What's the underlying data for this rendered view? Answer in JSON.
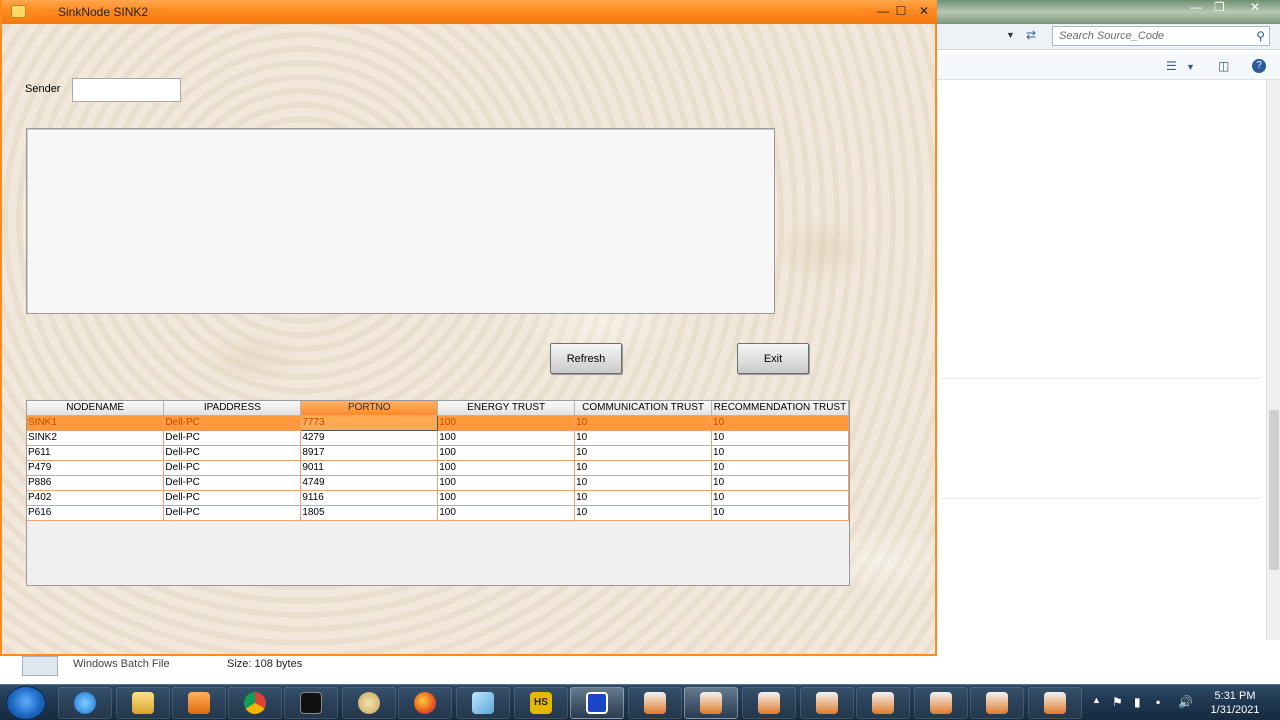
{
  "app": {
    "title": "SinkNode SINK2",
    "sender_label": "Sender",
    "sender_value": "",
    "message_text": "",
    "refresh_label": "Refresh",
    "exit_label": "Exit"
  },
  "table": {
    "columns": [
      "NODENAME",
      "IPADDRESS",
      "PORTNO",
      "ENERGY TRUST",
      "COMMUNICATION TRUST",
      "RECOMMENDATION TRUST"
    ],
    "selected_column": "PORTNO",
    "rows": [
      [
        "SINK1",
        "Dell-PC",
        "7773",
        "100",
        "10",
        "10"
      ],
      [
        "SINK2",
        "Dell-PC",
        "4279",
        "100",
        "10",
        "10"
      ],
      [
        "P611",
        "Dell-PC",
        "8917",
        "100",
        "10",
        "10"
      ],
      [
        "P479",
        "Dell-PC",
        "9011",
        "100",
        "10",
        "10"
      ],
      [
        "P886",
        "Dell-PC",
        "4749",
        "100",
        "10",
        "10"
      ],
      [
        "P402",
        "Dell-PC",
        "9116",
        "100",
        "10",
        "10"
      ],
      [
        "P616",
        "Dell-PC",
        "1805",
        "100",
        "10",
        "10"
      ]
    ],
    "selected_row": 0
  },
  "explorer": {
    "search_placeholder": "Search Source_Code",
    "file_type": "Windows Batch File",
    "size_label": "Size:",
    "size_value": "108 bytes"
  },
  "taskbar": {
    "time": "5:31 PM",
    "date": "1/31/2021",
    "apps": [
      "internet-explorer",
      "file-explorer",
      "media-player",
      "chrome",
      "command-prompt",
      "paint",
      "firefox",
      "notepad",
      "hs-app",
      "remote-app",
      "java-1",
      "java-2",
      "java-3",
      "java-4",
      "java-5",
      "java-6",
      "java-7",
      "java-8"
    ]
  },
  "colors": {
    "title_bar": "#ff8a1f",
    "selection": "#ff9a3c",
    "taskbar": "#1e3650"
  }
}
